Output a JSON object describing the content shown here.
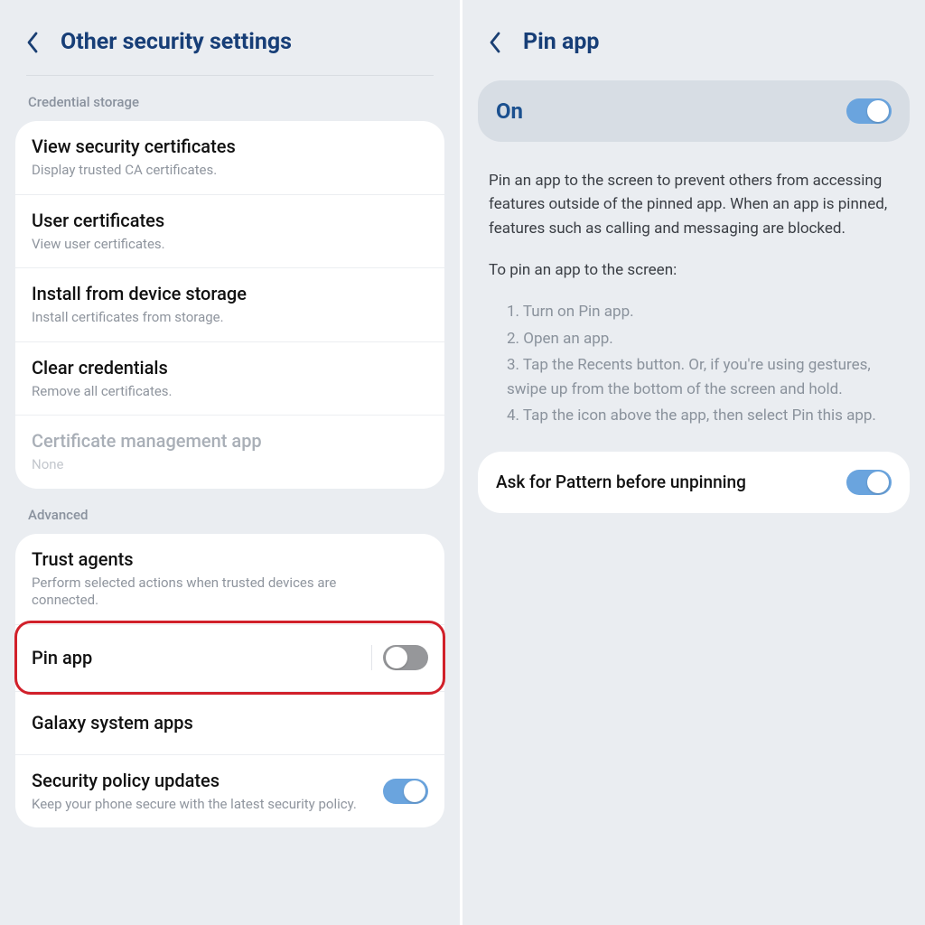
{
  "left": {
    "title": "Other security settings",
    "sections": {
      "credential": {
        "label": "Credential storage",
        "items": [
          {
            "title": "View security certificates",
            "sub": "Display trusted CA certificates."
          },
          {
            "title": "User certificates",
            "sub": "View user certificates."
          },
          {
            "title": "Install from device storage",
            "sub": "Install certificates from storage."
          },
          {
            "title": "Clear credentials",
            "sub": "Remove all certificates."
          },
          {
            "title": "Certificate management app",
            "sub": "None"
          }
        ]
      },
      "advanced": {
        "label": "Advanced",
        "items": [
          {
            "title": "Trust agents",
            "sub": "Perform selected actions when trusted devices are connected."
          },
          {
            "title": "Pin app"
          },
          {
            "title": "Galaxy system apps"
          },
          {
            "title": "Security policy updates",
            "sub": "Keep your phone secure with the latest security policy."
          }
        ]
      }
    }
  },
  "right": {
    "title": "Pin app",
    "on_label": "On",
    "description": "Pin an app to the screen to prevent others from accessing features outside of the pinned app. When an app is pinned, features such as calling and messaging are blocked.",
    "steps_intro": "To pin an app to the screen:",
    "steps": [
      "1. Turn on Pin app.",
      "2. Open an app.",
      "3. Tap the Recents button. Or, if you're using gestures, swipe up from the bottom of the screen and hold.",
      "4. Tap the icon above the app, then select Pin this app."
    ],
    "ask_pattern": "Ask for Pattern before unpinning"
  }
}
